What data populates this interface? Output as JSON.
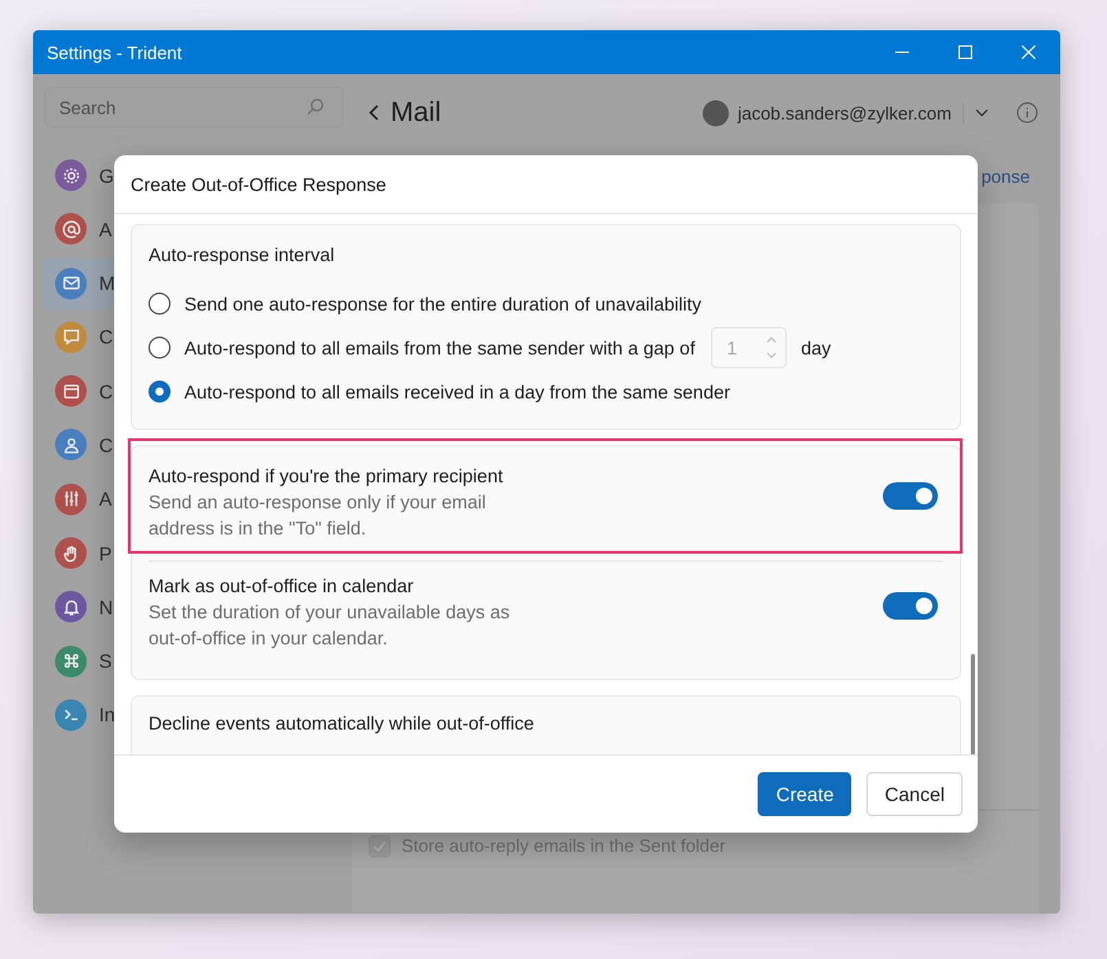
{
  "window": {
    "title": "Settings - Trident"
  },
  "sidebar": {
    "search": {
      "placeholder": "Search"
    },
    "items": [
      {
        "label": "G",
        "color": "#7b5b9c",
        "selected": false
      },
      {
        "label": "A",
        "color": "#b0504c",
        "selected": false
      },
      {
        "label": "M",
        "color": "#4a7fbf",
        "selected": true
      },
      {
        "label": "C",
        "color": "#c08b3c",
        "selected": false
      },
      {
        "label": "C",
        "color": "#b0504c",
        "selected": false
      },
      {
        "label": "C",
        "color": "#4a7fbf",
        "selected": false
      },
      {
        "label": "A",
        "color": "#b0504c",
        "selected": false
      },
      {
        "label": "P",
        "color": "#b0504c",
        "selected": false
      },
      {
        "label": "N",
        "color": "#6b58a0",
        "selected": false
      },
      {
        "label": "S",
        "color": "#3b8a6a",
        "selected": false
      },
      {
        "label": "In",
        "color": "#3a86b3",
        "selected": false
      }
    ]
  },
  "header": {
    "title": "Mail",
    "account": "jacob.sanders@zylker.com"
  },
  "background": {
    "link": "ponse",
    "store_option": {
      "label": "Store auto-reply emails in the Sent folder",
      "checked": true
    }
  },
  "dialog": {
    "title": "Create Out-of-Office Response",
    "interval": {
      "heading": "Auto-response interval",
      "options": [
        {
          "label": "Send one auto-response for the entire duration of unavailability",
          "selected": false
        },
        {
          "label": "Auto-respond to all emails from the same sender with a gap of",
          "selected": false,
          "gap_value": "1",
          "gap_unit": "day"
        },
        {
          "label": "Auto-respond to all emails received in a day from the same sender",
          "selected": true
        }
      ]
    },
    "toggles": [
      {
        "title": "Auto-respond if you're the primary recipient",
        "description": "Send an auto-response only if your email address is in the \"To\" field.",
        "on": true,
        "highlighted": true
      },
      {
        "title": "Mark as out-of-office in calendar",
        "description": "Set the duration of your unavailable days as out-of-office in your calendar.",
        "on": true,
        "highlighted": false
      }
    ],
    "decline": {
      "title": "Decline events automatically while out-of-office"
    },
    "buttons": [
      {
        "label": "Create",
        "kind": "primary"
      },
      {
        "label": "Cancel",
        "kind": "secondary"
      }
    ]
  }
}
